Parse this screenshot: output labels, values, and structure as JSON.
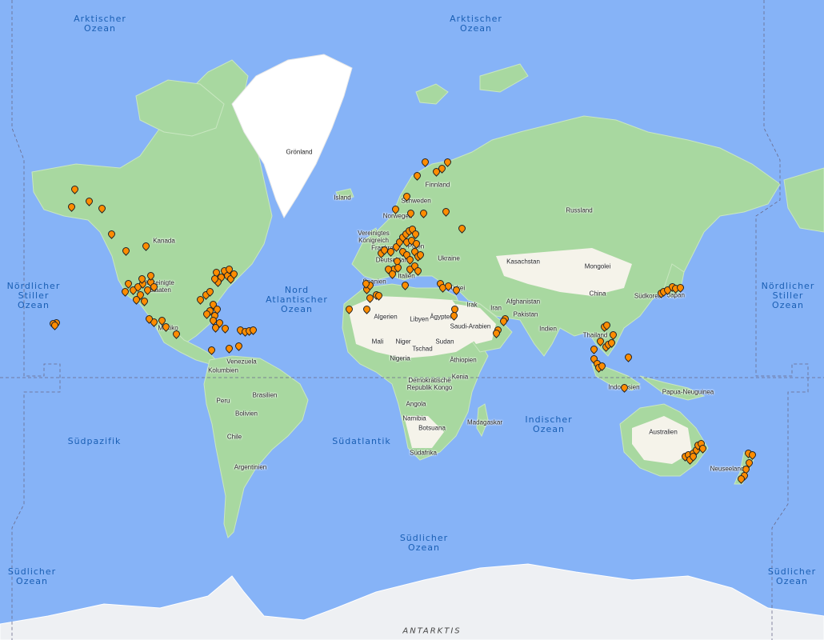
{
  "map": {
    "colors": {
      "water": "#86b3f7",
      "land": "#a8d8a0",
      "desert": "#f5f3ea",
      "ice": "#ffffff",
      "pin": "#ff8c00"
    },
    "country_labels": [
      "Grönland",
      "Island",
      "Finnland",
      "Schweden",
      "Norwegen",
      "Vereinigtes Königreich",
      "Russland",
      "Kanada",
      "Frankreich",
      "Polen",
      "Ukraine",
      "Deutschland",
      "Italien",
      "Spanien",
      "Türkei",
      "Kasachstan",
      "Mongolei",
      "China",
      "Südkorea",
      "Japan",
      "Vereinigte Staaten",
      "Mexiko",
      "Venezuela",
      "Kolumbien",
      "Peru",
      "Brasilien",
      "Bolivien",
      "Chile",
      "Argentinien",
      "Algerien",
      "Libyen",
      "Ägypten",
      "Saudi-Arabien",
      "Irak",
      "Iran",
      "Afghanistan",
      "Pakistan",
      "Indien",
      "Thailand",
      "Indonesien",
      "Papua-Neuguinea",
      "Australien",
      "Neuseeland",
      "Mali",
      "Niger",
      "Tschad",
      "Sudan",
      "Nigeria",
      "Äthiopien",
      "Demokratische Republik Kongo",
      "Kenia",
      "Angola",
      "Namibia",
      "Botsuana",
      "Madagaskar",
      "Südafrika"
    ],
    "ocean_labels": [
      "Arktischer Ozean",
      "Arktischer Ozean",
      "Nördlicher Stiller Ozean",
      "Nord Atlantischer Ozean",
      "Nördlicher Stiller Ozean",
      "Südpazifik",
      "Südatlantik",
      "Indischer Ozean",
      "Südlicher Ozean",
      "Südlicher Ozean",
      "Südlicher Ozean"
    ],
    "continent_label": "ANTARKTIS",
    "marker_count": 230
  }
}
